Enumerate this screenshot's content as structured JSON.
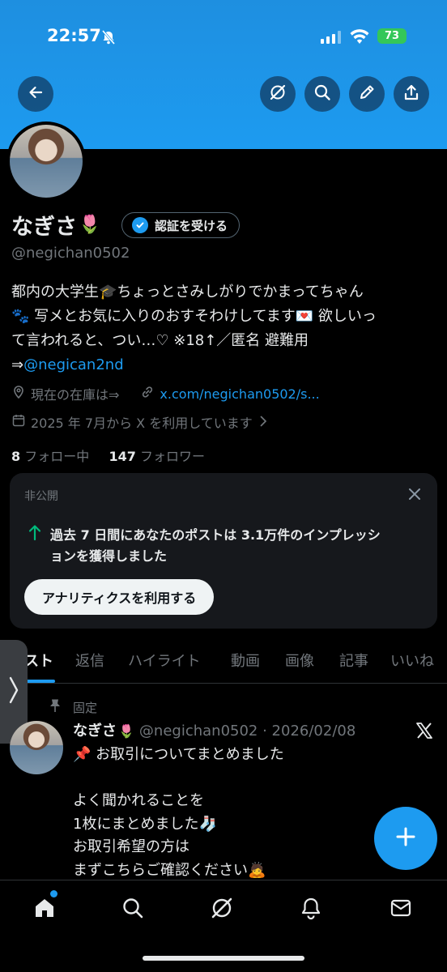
{
  "status_bar": {
    "time": "22:57",
    "battery": "73"
  },
  "header_icons": [
    "back-arrow-icon",
    "grok-icon",
    "search-icon",
    "edit-icon",
    "share-icon"
  ],
  "profile": {
    "name": "なぎさ",
    "verify_label": "認証を受ける",
    "handle": "@negichan0502",
    "bio_line1": "都内の大学生🎓ちょっとさみしがりでかまってちゃん",
    "bio_line2": "🐾 写メとお気に入りのおすそわけしてます💌 欲しいっ",
    "bio_line3": "て言われると、つい…♡ ※18↑／匿名 避難用",
    "bio_prefix": "⇒",
    "bio_link": "@negican2nd",
    "location": "現在の在庫は⇒",
    "website": "x.com/negichan0502/s...",
    "joined": "2025 年 7月から X を利用しています",
    "following_count": "8",
    "following_label": "フォロー中",
    "followers_count": "147",
    "followers_label": "フォロワー"
  },
  "analytics_card": {
    "label": "非公開",
    "message_line1": "過去 7 日間にあなたのポストは 3.1万件のインプレッシ",
    "message_line2": "ョンを獲得しました",
    "button": "アナリティクスを利用する"
  },
  "tabs": [
    "スト",
    "返信",
    "ハイライト",
    "動画",
    "画像",
    "記事",
    "いいね"
  ],
  "post": {
    "pinned_label": "固定",
    "author": "なぎさ",
    "handle_date": "@negichan0502 · 2026/02/08",
    "body": "📌 お取引についてまとめました\n\nよく聞かれることを\n1枚にまとめました🧦\nお取引希望の方は\nまずこちらご確認ください🙇"
  },
  "bottom_nav": [
    "home-icon",
    "search-icon",
    "grok-icon",
    "notifications-icon",
    "messages-icon"
  ],
  "colors": {
    "accent": "#1d9bf0",
    "background": "#000000",
    "muted": "#71767b",
    "text": "#e7e9ea"
  }
}
